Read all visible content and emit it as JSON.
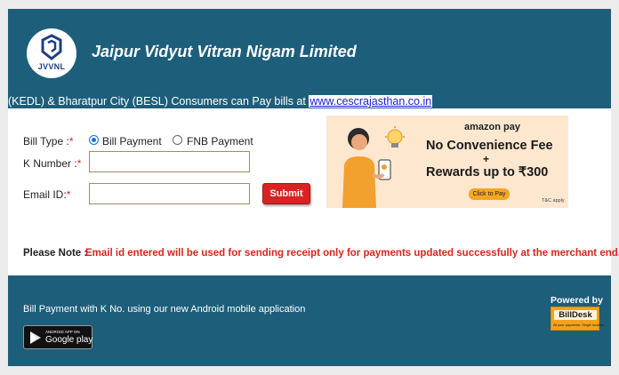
{
  "header": {
    "logo_text": "JVVNL",
    "org_title": "Jaipur Vidyut Vitran Nigam Limited",
    "notice_text": "(KEDL) & Bharatpur City (BESL) Consumers can Pay bills at ",
    "notice_link": "www.cescrajasthan.co.in"
  },
  "form": {
    "bill_type_label": "Bill Type :",
    "required_mark": "*",
    "bill_type_options": [
      "Bill Payment",
      "FNB Payment"
    ],
    "bill_type_selected": "Bill Payment",
    "k_number_label": "K Number :",
    "k_number_value": "",
    "email_label": "Email ID:",
    "email_value": "",
    "submit_label": "Submit"
  },
  "ad": {
    "brand": "amazon pay",
    "line1": "No Convenience Fee",
    "plus": "+",
    "line2": "Rewards up to ₹300",
    "cta": "Click to Pay",
    "tc": "T&C apply"
  },
  "note": {
    "label": "Please Note :",
    "text": "Email id entered will be used for sending receipt only for payments updated successfully at the merchant end."
  },
  "footer": {
    "app_text": "Bill Payment with K No. using our new Android mobile application",
    "gplay_small": "ANDROID APP ON",
    "gplay_big": "Google play",
    "powered_by": "Powered by",
    "billdesk_name": "BillDesk",
    "billdesk_tagline": "All your payments. Single location"
  },
  "colors": {
    "header_bg": "#1d5e7a",
    "alert_red": "#d9261c",
    "link_blue": "#1a1ad8",
    "submit_red": "#d92222",
    "ad_bg": "#fde7cf",
    "billdesk_orange": "#f4a11c"
  },
  "icons": {
    "logo": "jvvnl-logo-icon",
    "radio": "radio-icon",
    "ad_person": "person-with-phone-illustration",
    "ad_bulb": "lightbulb-icon",
    "play": "google-play-triangle-icon"
  }
}
